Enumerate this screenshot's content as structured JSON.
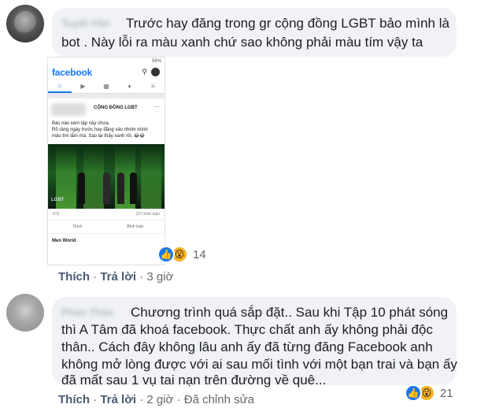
{
  "comments": [
    {
      "author": "Tuyết Vân",
      "text_line1": "Trước hay đăng trong gr cộng đồng LGBT bảo mình là",
      "text_line2": "bot . Này lỗi ra màu xanh chứ sao không phải màu tím vậy ta",
      "like_action": "Thích",
      "reply_action": "Trả lời",
      "time": "3 giờ",
      "reaction_count": "14"
    },
    {
      "author": "Phan Thảo",
      "lines": [
        "Chương trình quá sắp đặt.. Sau khi Tập 10 phát sóng",
        "thì A Tâm đã khoá facebook. Thực chất anh ấy không phải độc",
        "thân.. Cách đây không lâu anh ấy đã từng đăng Facebook anh",
        "không mở lòng được với ai sau mối tình với một bạn trai và bạn ấy",
        "đã mất sau 1 vụ tai nạn trên đường về quê..."
      ],
      "like_action": "Thích",
      "reply_action": "Trả lời",
      "time": "2 giờ",
      "edited": "Đã chỉnh sửa",
      "reaction_count": "21"
    }
  ],
  "screenshot": {
    "status": "56%",
    "logo": "facebook",
    "group": "CỘNG ĐỒNG LGBT",
    "post_lines": [
      "Bác nào xem tập này chưa.",
      "Rõ ràng ngày trước hay đăng vào nhóm mình",
      "màu tím lắm mà. Sao lại thấy xanh rồi. 😂😂"
    ],
    "show_logo": "LGBT",
    "reaction_count": "672",
    "comment_count": "227 bình luận",
    "like_label": "Thích",
    "comment_label": "Bình luận",
    "next_post": "Men World"
  },
  "colors": {
    "bubble": "#f0f2f5",
    "facebook_blue": "#1877f2",
    "action_text": "#4b5a73"
  }
}
